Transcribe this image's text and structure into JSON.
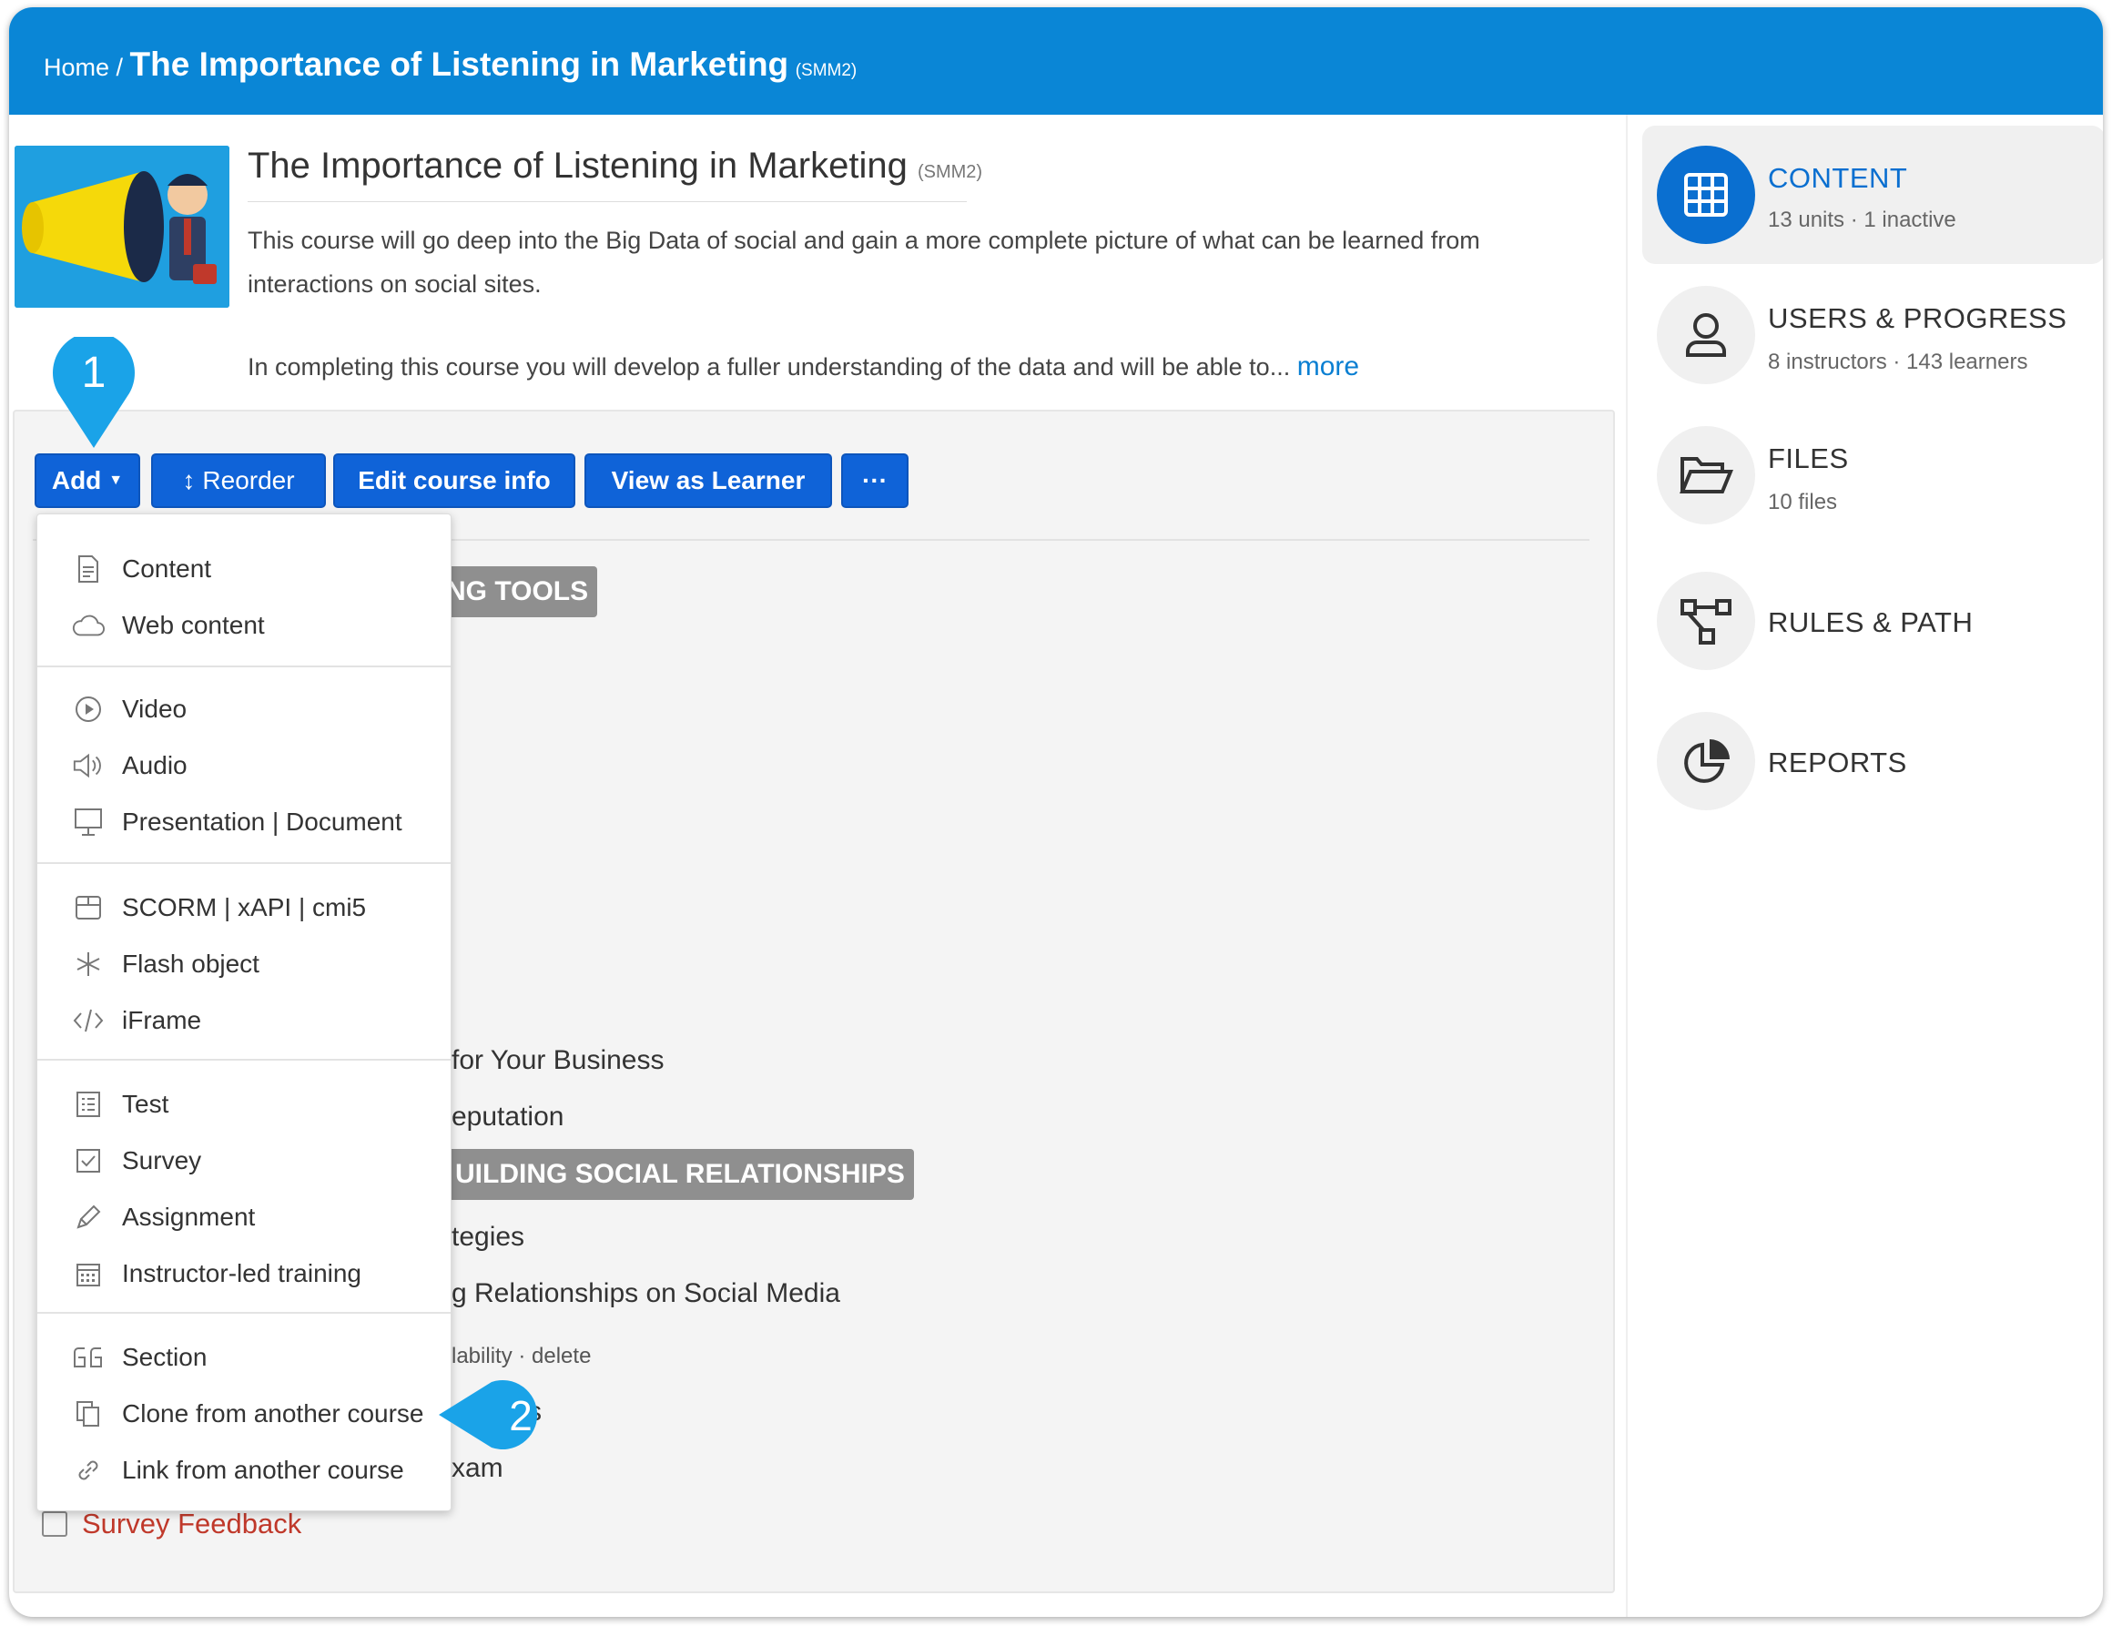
{
  "breadcrumb": {
    "home": "Home /",
    "title": "The Importance of Listening in Marketing",
    "code": "(SMM2)"
  },
  "course": {
    "title": "The Importance of Listening in Marketing",
    "code": "(SMM2)",
    "description": "This course will go deep into the Big Data of social and gain a more complete picture of what can be learned from interactions on social sites.",
    "description2": "In completing this course you will develop a fuller understanding of the data and will be able to...",
    "more": "more"
  },
  "toolbar": {
    "add": "Add",
    "reorder": "Reorder",
    "edit": "Edit course info",
    "view": "View as Learner",
    "more": "···"
  },
  "background_units": {
    "section1": "NG TOOLS",
    "item1": "for Your Business",
    "item2": "eputation",
    "section2": "UILDING SOCIAL RELATIONSHIPS",
    "item3": "tegies",
    "item4": "g Relationships on Social Media",
    "links": "lability · delete",
    "item5": "s",
    "item6": "xam",
    "survey": "Survey Feedback"
  },
  "add_menu": {
    "items": [
      {
        "label": "Content",
        "icon": "document-icon"
      },
      {
        "label": "Web content",
        "icon": "cloud-icon"
      },
      {
        "label": "Video",
        "icon": "play-icon"
      },
      {
        "label": "Audio",
        "icon": "speaker-icon"
      },
      {
        "label": "Presentation | Document",
        "icon": "presentation-icon"
      },
      {
        "label": "SCORM | xAPI | cmi5",
        "icon": "package-icon"
      },
      {
        "label": "Flash object",
        "icon": "asterisk-icon"
      },
      {
        "label": "iFrame",
        "icon": "code-icon"
      },
      {
        "label": "Test",
        "icon": "checklist-icon"
      },
      {
        "label": "Survey",
        "icon": "checkbox-icon"
      },
      {
        "label": "Assignment",
        "icon": "pencil-icon"
      },
      {
        "label": "Instructor-led training",
        "icon": "calendar-icon"
      },
      {
        "label": "Section",
        "icon": "quote-icon"
      },
      {
        "label": "Clone from another course",
        "icon": "copy-icon"
      },
      {
        "label": "Link from another course",
        "icon": "link-icon"
      }
    ]
  },
  "callouts": {
    "one": "1",
    "two": "2"
  },
  "sidebar": {
    "items": [
      {
        "label": "CONTENT",
        "sub": "13 units · 1 inactive",
        "icon": "grid-icon"
      },
      {
        "label": "USERS & PROGRESS",
        "sub": "8 instructors · 143 learners",
        "icon": "user-icon"
      },
      {
        "label": "FILES",
        "sub": "10 files",
        "icon": "folder-icon"
      },
      {
        "label": "RULES & PATH",
        "sub": "",
        "icon": "path-icon"
      },
      {
        "label": "REPORTS",
        "sub": "",
        "icon": "pie-chart-icon"
      }
    ]
  },
  "colors": {
    "header": "#0a86d6",
    "button": "#0f63d8",
    "accent": "#0a6fd0",
    "callout": "#1aa3e8",
    "survey_text": "#c0392b"
  }
}
